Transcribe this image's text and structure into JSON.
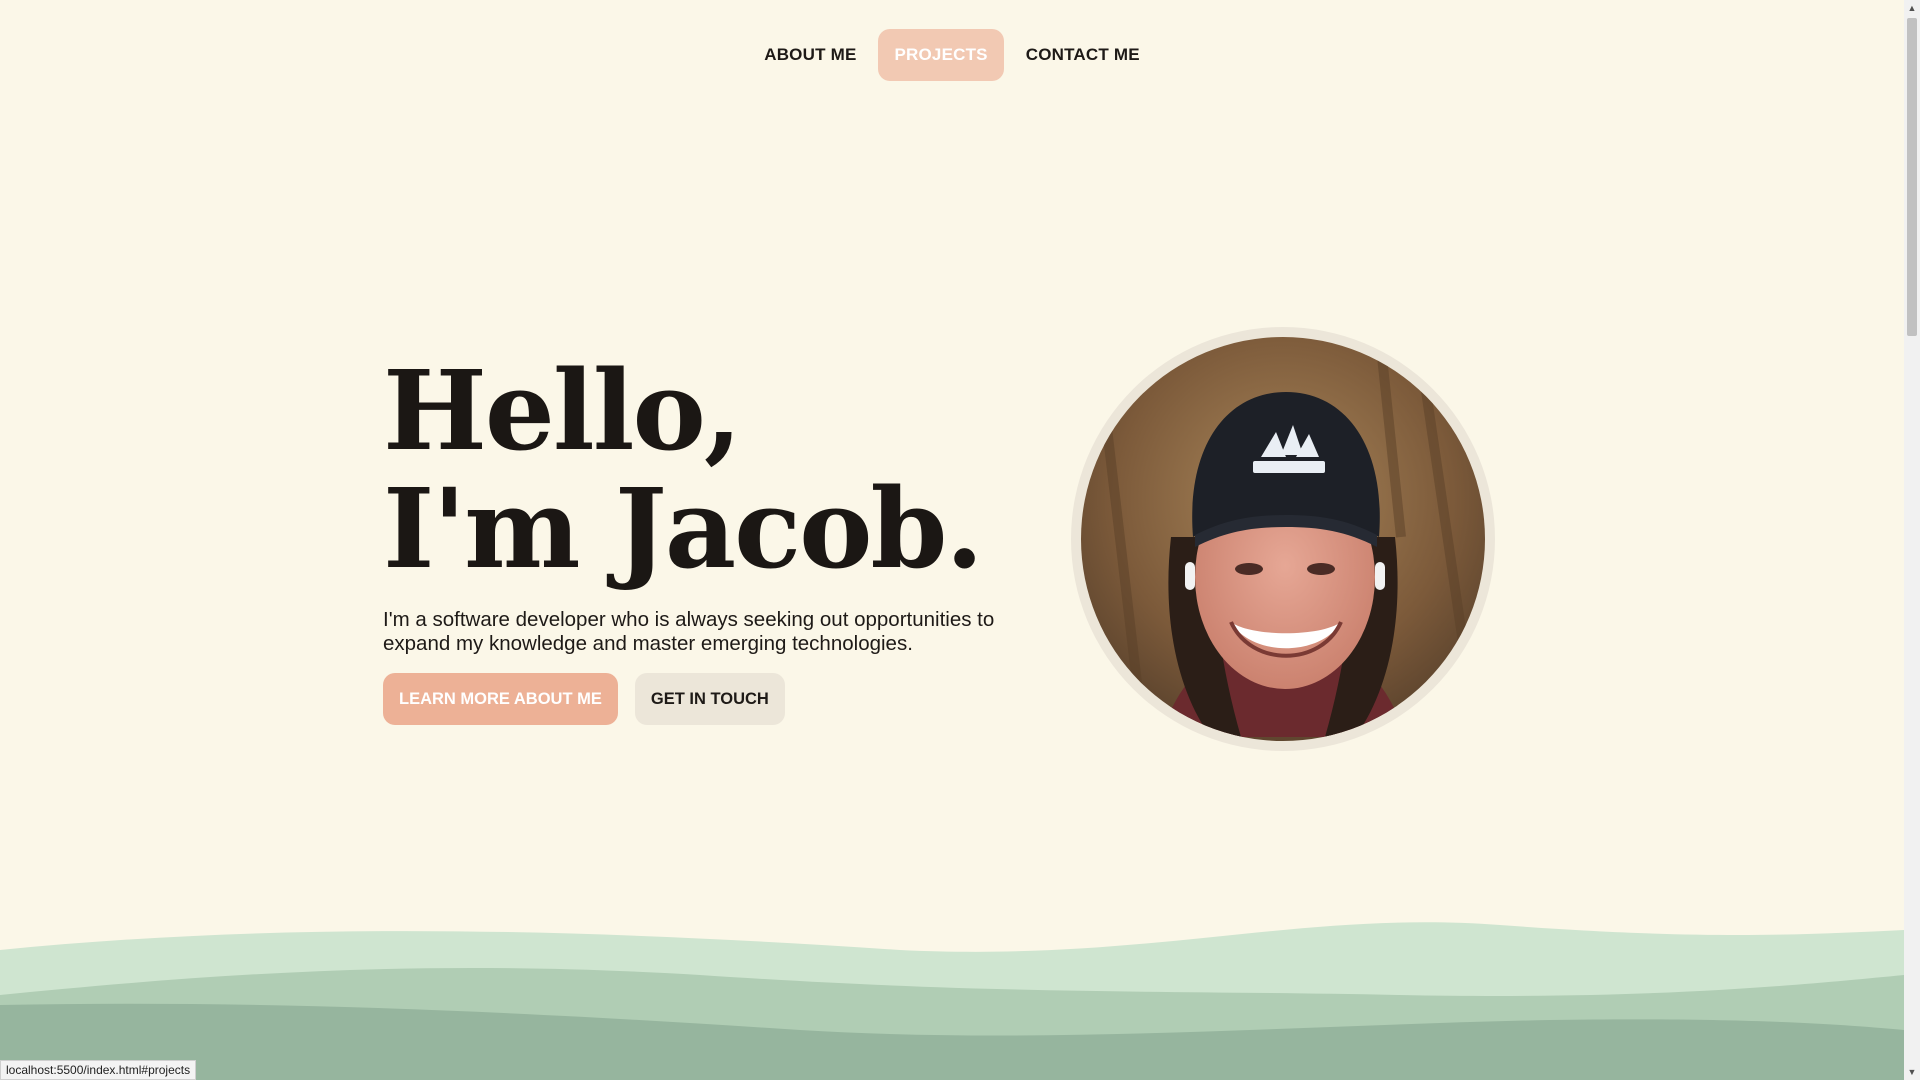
{
  "nav": {
    "items": [
      {
        "label": "ABOUT ME",
        "active": false
      },
      {
        "label": "PROJECTS",
        "active": true
      },
      {
        "label": "CONTACT ME",
        "active": false
      }
    ]
  },
  "hero": {
    "title_line1": "Hello,",
    "title_line2": "I'm Jacob.",
    "description": "I'm a software developer who is always seeking out opportunities to expand my knowledge and master emerging technologies.",
    "primary_button": "LEARN MORE ABOUT ME",
    "secondary_button": "GET IN TOUCH"
  },
  "status_bar": {
    "url": "localhost:5500/index.html#projects"
  },
  "colors": {
    "background": "#fbf7e8",
    "accent": "#edb196",
    "nav_active": "#f2c9b3",
    "secondary": "#ece6d9",
    "wave_light": "#cfe5d0",
    "wave_mid": "#b0cdb4",
    "wave_dark": "#96b59e"
  },
  "icons": {
    "scroll_up": "triangle-up-icon",
    "scroll_down": "triangle-down-icon"
  }
}
